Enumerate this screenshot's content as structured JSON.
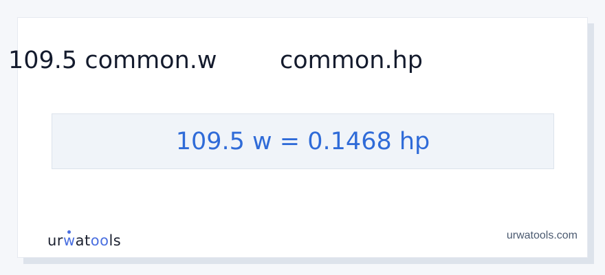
{
  "conversion": {
    "from_label": "109.5 common.w",
    "to_label": "common.hp",
    "result": "109.5 w = 0.1468 hp"
  },
  "branding": {
    "logo_prefix": "ur",
    "logo_accent": "w",
    "logo_mid": "at",
    "logo_accent2": "oo",
    "logo_suffix": "ls",
    "site": "urwatools.com",
    "accent_color": "#4a6fe0"
  },
  "colors": {
    "result_text": "#2f6bd8",
    "result_bg": "#f0f4f9",
    "heading_text": "#141b2d"
  }
}
